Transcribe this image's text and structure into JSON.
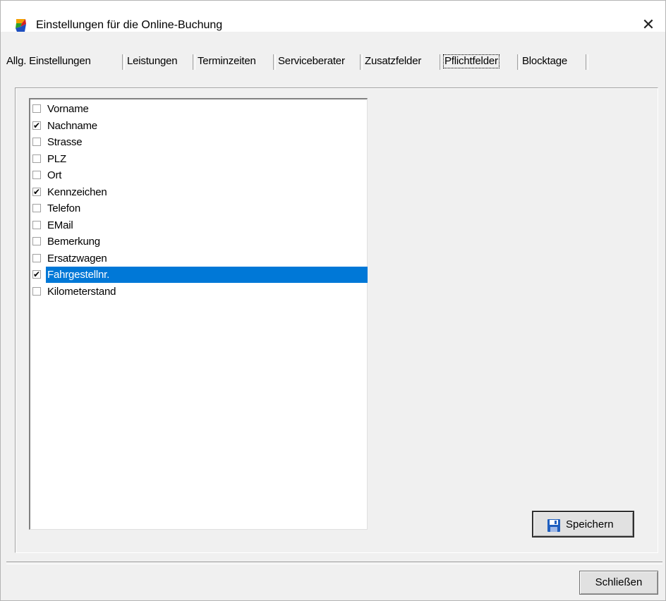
{
  "window": {
    "title": "Einstellungen für die Online-Buchung"
  },
  "tabs": [
    {
      "label": "Allg. Einstellungen"
    },
    {
      "label": "Leistungen"
    },
    {
      "label": "Terminzeiten"
    },
    {
      "label": "Serviceberater"
    },
    {
      "label": "Zusatzfelder"
    },
    {
      "label": "Pflichtfelder",
      "active": true
    },
    {
      "label": "Blocktage"
    }
  ],
  "fields": [
    {
      "label": "Vorname",
      "checked": false
    },
    {
      "label": "Nachname",
      "checked": true
    },
    {
      "label": "Strasse",
      "checked": false
    },
    {
      "label": "PLZ",
      "checked": false
    },
    {
      "label": "Ort",
      "checked": false
    },
    {
      "label": "Kennzeichen",
      "checked": true
    },
    {
      "label": "Telefon",
      "checked": false
    },
    {
      "label": "EMail",
      "checked": false
    },
    {
      "label": "Bemerkung",
      "checked": false
    },
    {
      "label": "Ersatzwagen",
      "checked": false
    },
    {
      "label": "Fahrgestellnr.",
      "checked": true,
      "selected": true
    },
    {
      "label": "Kilometerstand",
      "checked": false
    }
  ],
  "buttons": {
    "save": "Speichern",
    "close": "Schließen"
  },
  "colors": {
    "selection": "#0078d7",
    "floppy": "#1f5fbf"
  }
}
